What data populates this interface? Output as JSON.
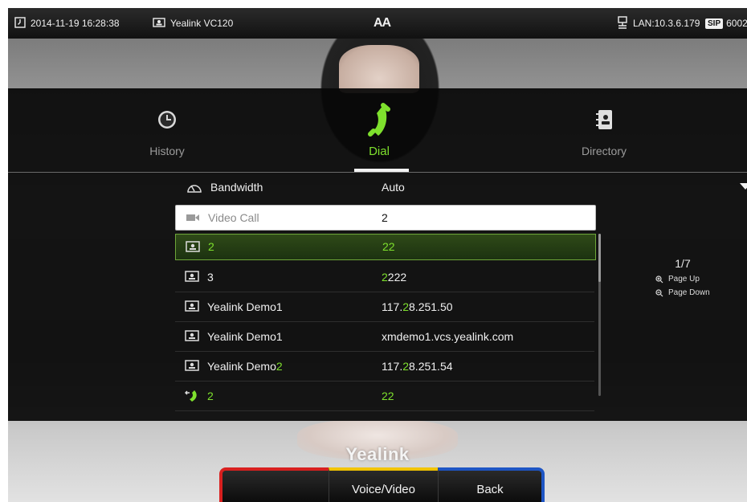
{
  "status_bar": {
    "datetime": "2014-11-19 16:28:38",
    "device": "Yealink VC120",
    "aa": "AA",
    "lan": "LAN:10.3.6.179",
    "sip_badge": "SIP",
    "sip_account": "6002"
  },
  "tabs": [
    {
      "label": "History",
      "icon": "clock-icon",
      "active": false
    },
    {
      "label": "Dial",
      "icon": "phone-handset-icon",
      "active": true
    },
    {
      "label": "Directory",
      "icon": "contacts-book-icon",
      "active": false
    }
  ],
  "bandwidth": {
    "label": "Bandwidth",
    "value": "Auto",
    "icon": "gauge-icon"
  },
  "video_call": {
    "label": "Video Call",
    "value": "2",
    "icon": "video-camera-icon"
  },
  "rows": [
    {
      "name": "2",
      "value": "22",
      "icon": "contact-card-icon",
      "selected": true
    },
    {
      "name": "3",
      "value_hl": "2",
      "value_rest": "222",
      "icon": "contact-card-icon"
    },
    {
      "name": "Yealink Demo1",
      "value_pre": "117.",
      "value_hl": "2",
      "value_post": "8.251.50",
      "icon": "contact-card-icon"
    },
    {
      "name": "Yealink Demo1",
      "value": "xmdemo1.vcs.yealink.com",
      "icon": "contact-card-icon"
    },
    {
      "name_pre": "Yealink Demo",
      "name_hl": "2",
      "value_pre": "117.",
      "value_hl": "2",
      "value_post": "8.251.54",
      "icon": "contact-card-icon"
    },
    {
      "name": "2",
      "value": "22",
      "icon": "incoming-call-icon"
    }
  ],
  "pager": {
    "count": "1/7",
    "page_up": "Page Up",
    "page_down": "Page Down"
  },
  "brand": "Yealink",
  "softkeys": {
    "key1": "",
    "key2": "Voice/Video",
    "key3": "Back"
  },
  "colors": {
    "accent_green": "#7ee02d",
    "red": "#d8201f",
    "yellow": "#f1c400",
    "blue": "#1e55c4"
  }
}
